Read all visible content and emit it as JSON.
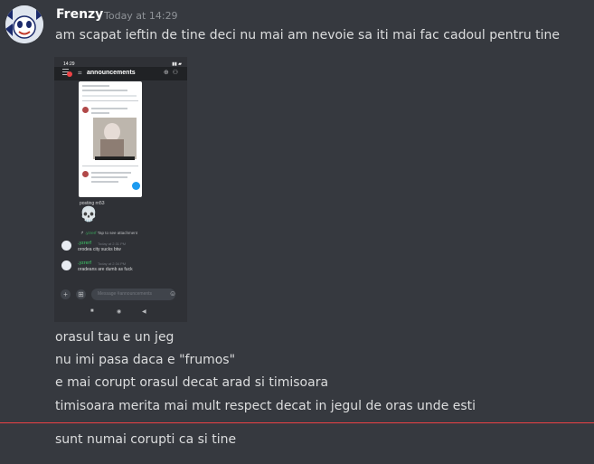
{
  "message": {
    "author": "Frenzy",
    "timestamp": "Today at 14:29",
    "lines_before_image": [
      "am scapat ieftin de tine deci nu mai am nevoie sa iti mai fac cadoul pentru tine"
    ],
    "lines_after_image": [
      "orasul tau e un jeg",
      "nu imi pasa daca e \"frumos\"",
      "e mai corupt orasul decat arad si timisoara",
      "timisoara merita mai mult respect decat in jegul de oras unde esti"
    ],
    "new_line": "sunt numai corupti ca si tine"
  },
  "attachment": {
    "status_time": "14:29",
    "channel": "announcements",
    "posting_text": "posting rn53",
    "reply_hint": "Tap to see attachment",
    "reply_name": ".yzrerf",
    "messages": [
      {
        "name": ".yzrerf",
        "time": "Today at 2:31 PM",
        "text": "orodea city sucks btw"
      },
      {
        "name": ".yzrerf",
        "time": "Today at 2:34 PM",
        "text": "oradeans are dumb as fuck"
      }
    ],
    "input_placeholder": "Message #announcements"
  },
  "colors": {
    "background": "#36393f",
    "new_divider": "#ed4245",
    "username_green": "#3ba55c"
  }
}
